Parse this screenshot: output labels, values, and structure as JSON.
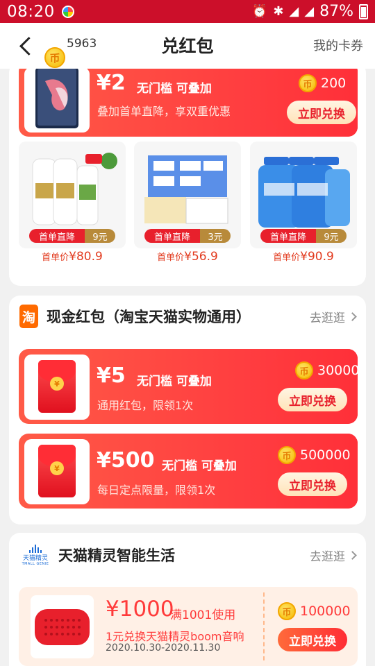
{
  "status_bar": {
    "time": "08:20",
    "battery": "87%",
    "network": "4G"
  },
  "nav": {
    "title": "兑红包",
    "coin_balance": "5963",
    "right_link": "我的卡券"
  },
  "top_voucher": {
    "amount": "¥2",
    "tags": "无门槛 可叠加",
    "desc": "叠加首单直降，享双重优惠",
    "price": "200",
    "button": "立即兑换"
  },
  "products": [
    {
      "badge": "首单直降",
      "discount": "9元",
      "price_label": "首单价",
      "price": "¥80.9"
    },
    {
      "badge": "首单直降",
      "discount": "3元",
      "price_label": "首单价",
      "price": "¥56.9"
    },
    {
      "badge": "首单直降",
      "discount": "9元",
      "price_label": "首单价",
      "price": "¥90.9"
    }
  ],
  "cash_section": {
    "icon_char": "淘",
    "title": "现金红包（淘宝天猫实物通用）",
    "link": "去逛逛",
    "vouchers": [
      {
        "amount": "¥5",
        "tags": "无门槛 可叠加",
        "desc": "通用红包，限领1次",
        "price": "30000",
        "button": "立即兑换"
      },
      {
        "amount": "¥500",
        "tags": "无门槛 可叠加",
        "desc": "每日定点限量，限领1次",
        "price": "500000",
        "button": "立即兑换"
      }
    ]
  },
  "genie_section": {
    "logo_text": "天猫精灵",
    "logo_sub": "TMALL GENIE",
    "title": "天猫精灵智能生活",
    "link": "去逛逛",
    "voucher": {
      "amount": "¥1000",
      "condition": "满1001使用",
      "desc": "1元兑换天猫精灵boom音响",
      "date": "2020.10.30-2020.11.30",
      "price": "100000",
      "button": "立即兑换"
    }
  },
  "colors": {
    "status_bar": "#cc0f2a",
    "voucher_red": "#ff3b3e",
    "price_orange": "#e23a1e",
    "coin_gold": "#f5b800"
  }
}
